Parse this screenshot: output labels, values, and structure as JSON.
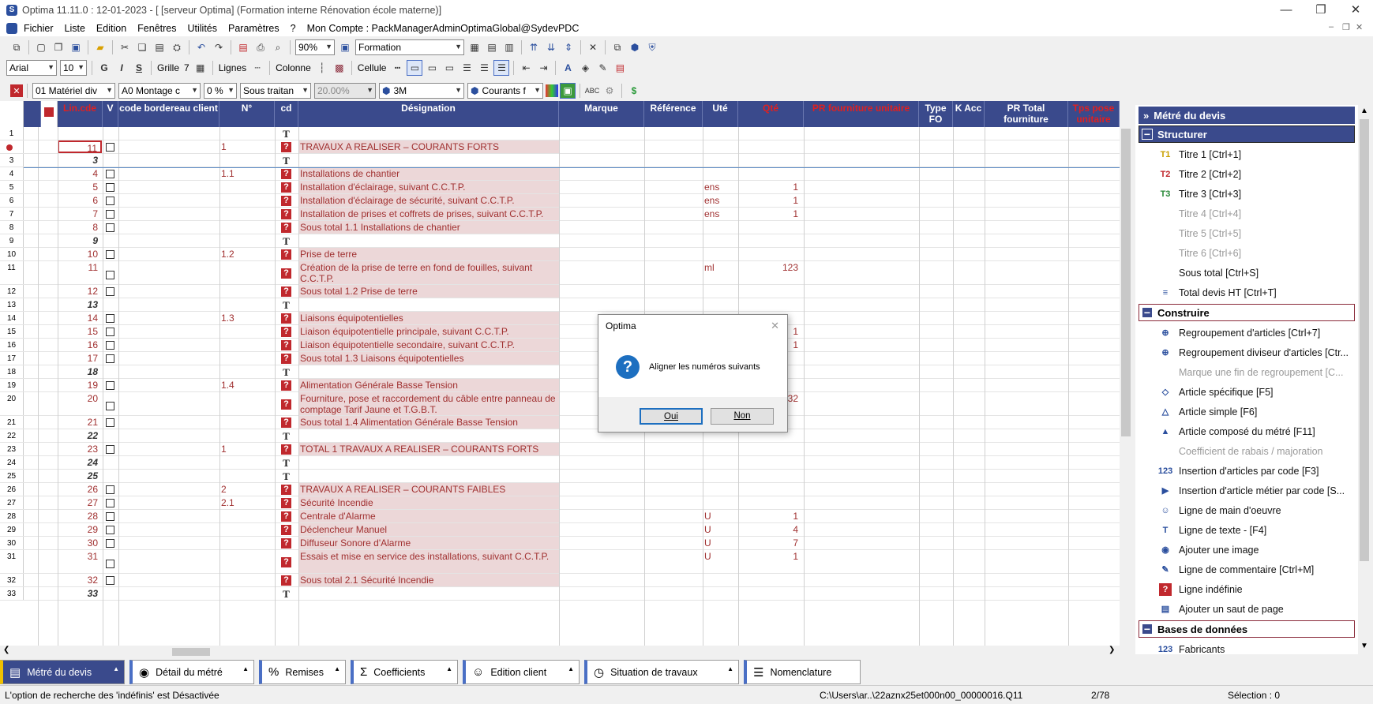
{
  "window": {
    "title": "Optima 11.11.0 : 12-01-2023 - [ [serveur Optima] (Formation interne Rénovation école materne)]"
  },
  "menu": [
    "Fichier",
    "Liste",
    "Edition",
    "Fenêtres",
    "Utilités",
    "Paramètres",
    "?",
    "Mon Compte : PackManagerAdminOptimaGlobal@SydevPDC"
  ],
  "toolbar1": {
    "zoom": "90%",
    "profile": "Formation"
  },
  "toolbar2": {
    "font": "Arial",
    "size": "10",
    "grid_label": "Grille",
    "grid_value": "7",
    "lines_label": "Lignes",
    "columns_label": "Colonne",
    "cell_label": "Cellule"
  },
  "toolbar3": {
    "filter1": "01  Matériel div",
    "filter2": "A0  Montage c",
    "filter3": "0 %",
    "filter4": "Sous traitan",
    "filter5": "20.00%",
    "filter6": "3M",
    "filter7": "Courants f"
  },
  "grid": {
    "headers": [
      "Lin.cde",
      "V",
      "code bordereau client",
      "N°",
      "cd",
      "Désignation",
      "Marque",
      "Référence",
      "Uté",
      "Qté",
      "PR fourniture unitaire",
      "Type FO",
      "K Acc",
      "PR Total fourniture",
      "Tps pose unitaire"
    ],
    "rows": [
      {
        "rn": "1",
        "ln": "",
        "it": false,
        "cb": false,
        "num": "",
        "cd": "T",
        "des": "",
        "ute": "",
        "qte": ""
      },
      {
        "rn": "",
        "ln": "11",
        "it": false,
        "cb": true,
        "num": "1",
        "cd": "?",
        "des": "TRAVAUX A REALISER – COURANTS FORTS",
        "ute": "",
        "qte": ""
      },
      {
        "rn": "3",
        "ln": "3",
        "it": true,
        "cb": false,
        "num": "",
        "cd": "T",
        "des": "",
        "ute": "",
        "qte": ""
      },
      {
        "rn": "4",
        "ln": "4",
        "it": false,
        "cb": true,
        "num": "1.1",
        "cd": "?",
        "des": "Installations de chantier",
        "ute": "",
        "qte": ""
      },
      {
        "rn": "5",
        "ln": "5",
        "it": false,
        "cb": true,
        "num": "",
        "cd": "?",
        "des": "Installation d'éclairage, suivant C.C.T.P.",
        "ute": "ens",
        "qte": "1"
      },
      {
        "rn": "6",
        "ln": "6",
        "it": false,
        "cb": true,
        "num": "",
        "cd": "?",
        "des": "Installation d'éclairage de sécurité, suivant C.C.T.P.",
        "ute": "ens",
        "qte": "1"
      },
      {
        "rn": "7",
        "ln": "7",
        "it": false,
        "cb": true,
        "num": "",
        "cd": "?",
        "des": "Installation de prises et coffrets de prises, suivant C.C.T.P.",
        "ute": "ens",
        "qte": "1"
      },
      {
        "rn": "8",
        "ln": "8",
        "it": false,
        "cb": true,
        "num": "",
        "cd": "?",
        "des": "Sous total 1.1 Installations de chantier",
        "ute": "",
        "qte": ""
      },
      {
        "rn": "9",
        "ln": "9",
        "it": true,
        "cb": false,
        "num": "",
        "cd": "T",
        "des": "",
        "ute": "",
        "qte": ""
      },
      {
        "rn": "10",
        "ln": "10",
        "it": false,
        "cb": true,
        "num": "1.2",
        "cd": "?",
        "des": "Prise de terre",
        "ute": "",
        "qte": ""
      },
      {
        "rn": "11",
        "ln": "11",
        "it": false,
        "cb": true,
        "num": "",
        "cd": "?",
        "des": "Création de la prise de terre en fond de fouilles, suivant C.C.T.P.",
        "ute": "ml",
        "qte": "123",
        "tall": true
      },
      {
        "rn": "12",
        "ln": "12",
        "it": false,
        "cb": true,
        "num": "",
        "cd": "?",
        "des": "Sous total 1.2 Prise de terre",
        "ute": "",
        "qte": ""
      },
      {
        "rn": "13",
        "ln": "13",
        "it": true,
        "cb": false,
        "num": "",
        "cd": "T",
        "des": "",
        "ute": "",
        "qte": ""
      },
      {
        "rn": "14",
        "ln": "14",
        "it": false,
        "cb": true,
        "num": "1.3",
        "cd": "?",
        "des": "Liaisons équipotentielles",
        "ute": "",
        "qte": ""
      },
      {
        "rn": "15",
        "ln": "15",
        "it": false,
        "cb": true,
        "num": "",
        "cd": "?",
        "des": "Liaison équipotentielle principale, suivant C.C.T.P.",
        "ute": "",
        "qte": "1"
      },
      {
        "rn": "16",
        "ln": "16",
        "it": false,
        "cb": true,
        "num": "",
        "cd": "?",
        "des": "Liaison équipotentielle secondaire, suivant C.C.T.P.",
        "ute": "",
        "qte": "1"
      },
      {
        "rn": "17",
        "ln": "17",
        "it": false,
        "cb": true,
        "num": "",
        "cd": "?",
        "des": "Sous total 1.3 Liaisons équipotentielles",
        "ute": "",
        "qte": ""
      },
      {
        "rn": "18",
        "ln": "18",
        "it": true,
        "cb": false,
        "num": "",
        "cd": "T",
        "des": "",
        "ute": "",
        "qte": ""
      },
      {
        "rn": "19",
        "ln": "19",
        "it": false,
        "cb": true,
        "num": "1.4",
        "cd": "?",
        "des": "Alimentation Générale Basse Tension",
        "ute": "",
        "qte": ""
      },
      {
        "rn": "20",
        "ln": "20",
        "it": false,
        "cb": true,
        "num": "",
        "cd": "?",
        "des": "Fourniture, pose et raccordement du câble entre panneau de comptage Tarif Jaune et T.G.B.T.",
        "ute": "",
        "qte": "32",
        "tall": true
      },
      {
        "rn": "21",
        "ln": "21",
        "it": false,
        "cb": true,
        "num": "",
        "cd": "?",
        "des": "Sous total 1.4 Alimentation Générale Basse Tension",
        "ute": "",
        "qte": ""
      },
      {
        "rn": "22",
        "ln": "22",
        "it": true,
        "cb": false,
        "num": "",
        "cd": "T",
        "des": "",
        "ute": "",
        "qte": ""
      },
      {
        "rn": "23",
        "ln": "23",
        "it": false,
        "cb": true,
        "num": "1",
        "cd": "?",
        "des": "TOTAL 1 TRAVAUX A REALISER – COURANTS FORTS",
        "ute": "",
        "qte": ""
      },
      {
        "rn": "24",
        "ln": "24",
        "it": true,
        "cb": false,
        "num": "",
        "cd": "T",
        "des": "",
        "ute": "",
        "qte": ""
      },
      {
        "rn": "25",
        "ln": "25",
        "it": true,
        "cb": false,
        "num": "",
        "cd": "T",
        "des": "",
        "ute": "",
        "qte": ""
      },
      {
        "rn": "26",
        "ln": "26",
        "it": false,
        "cb": true,
        "num": "2",
        "cd": "?",
        "des": "TRAVAUX A REALISER – COURANTS FAIBLES",
        "ute": "",
        "qte": ""
      },
      {
        "rn": "27",
        "ln": "27",
        "it": false,
        "cb": true,
        "num": "2.1",
        "cd": "?",
        "des": "Sécurité Incendie",
        "ute": "",
        "qte": ""
      },
      {
        "rn": "28",
        "ln": "28",
        "it": false,
        "cb": true,
        "num": "",
        "cd": "?",
        "des": "Centrale d'Alarme",
        "ute": "U",
        "qte": "1"
      },
      {
        "rn": "29",
        "ln": "29",
        "it": false,
        "cb": true,
        "num": "",
        "cd": "?",
        "des": "Déclencheur Manuel",
        "ute": "U",
        "qte": "4"
      },
      {
        "rn": "30",
        "ln": "30",
        "it": false,
        "cb": true,
        "num": "",
        "cd": "?",
        "des": "Diffuseur Sonore d'Alarme",
        "ute": "U",
        "qte": "7"
      },
      {
        "rn": "31",
        "ln": "31",
        "it": false,
        "cb": true,
        "num": "",
        "cd": "?",
        "des": "Essais et mise en service des installations, suivant C.C.T.P.",
        "ute": "U",
        "qte": "1",
        "tall": true
      },
      {
        "rn": "32",
        "ln": "32",
        "it": false,
        "cb": true,
        "num": "",
        "cd": "?",
        "des": "Sous total 2.1 Sécurité Incendie",
        "ute": "",
        "qte": ""
      },
      {
        "rn": "33",
        "ln": "33",
        "it": true,
        "cb": false,
        "num": "",
        "cd": "T",
        "des": "",
        "ute": "",
        "qte": ""
      }
    ]
  },
  "side": {
    "title": "Métré du devis",
    "groups": [
      {
        "label": "Structurer",
        "items": [
          {
            "label": "Titre 1 [Ctrl+1]",
            "icon": "T1",
            "gray": false
          },
          {
            "label": "Titre 2 [Ctrl+2]",
            "icon": "T2",
            "gray": false
          },
          {
            "label": "Titre 3 [Ctrl+3]",
            "icon": "T3",
            "gray": false
          },
          {
            "label": "Titre 4 [Ctrl+4]",
            "icon": "",
            "gray": true
          },
          {
            "label": "Titre 5 [Ctrl+5]",
            "icon": "",
            "gray": true
          },
          {
            "label": "Titre 6 [Ctrl+6]",
            "icon": "",
            "gray": true
          },
          {
            "label": "Sous total [Ctrl+S]",
            "icon": "",
            "gray": false
          },
          {
            "label": "Total devis HT [Ctrl+T]",
            "icon": "≡",
            "gray": false
          }
        ]
      },
      {
        "label": "Construire",
        "items": [
          {
            "label": "Regroupement d'articles  [Ctrl+7]",
            "icon": "⊕",
            "gray": false
          },
          {
            "label": "Regroupement diviseur d'articles [Ctr...",
            "icon": "⊕",
            "gray": false
          },
          {
            "label": "Marque une fin de regroupement   [C...",
            "icon": "",
            "gray": true
          },
          {
            "label": "Article spécifique [F5]",
            "icon": "◇",
            "gray": false
          },
          {
            "label": "Article simple [F6]",
            "icon": "△",
            "gray": false
          },
          {
            "label": "Article composé du métré [F11]",
            "icon": "▲",
            "gray": false
          },
          {
            "label": "Coefficient de rabais / majoration",
            "icon": "",
            "gray": true
          },
          {
            "label": "Insertion d'articles par code [F3]",
            "icon": "123",
            "gray": false
          },
          {
            "label": "Insertion d'article métier par code [S...",
            "icon": "▶",
            "gray": false
          },
          {
            "label": "Ligne de main d'oeuvre",
            "icon": "☺",
            "gray": false
          },
          {
            "label": "Ligne de texte - [F4]",
            "icon": "T",
            "gray": false
          },
          {
            "label": "Ajouter une image",
            "icon": "◉",
            "gray": false
          },
          {
            "label": "Ligne de commentaire [Ctrl+M]",
            "icon": "✎",
            "gray": false
          },
          {
            "label": "Ligne indéfinie",
            "icon": "?",
            "gray": false
          },
          {
            "label": "Ajouter un saut de page",
            "icon": "▤",
            "gray": false
          }
        ]
      },
      {
        "label": "Bases de données",
        "items": [
          {
            "label": "Fabricants",
            "icon": "123",
            "gray": false
          }
        ]
      }
    ]
  },
  "tabs": [
    "Métré du devis",
    "Détail du métré",
    "Remises",
    "Coefficients",
    "Edition client",
    "Situation de travaux",
    "Nomenclature"
  ],
  "status": {
    "message": "L'option de recherche des 'indéfinis' est Désactivée",
    "path": "C:\\Users\\ar..\\22aznx25et000n00_00000016.Q11",
    "page": "2/78",
    "selection": "Sélection : 0"
  },
  "dialog": {
    "title": "Optima",
    "message": "Aligner les numéros suivants",
    "yes": "Oui",
    "no": "Non"
  }
}
